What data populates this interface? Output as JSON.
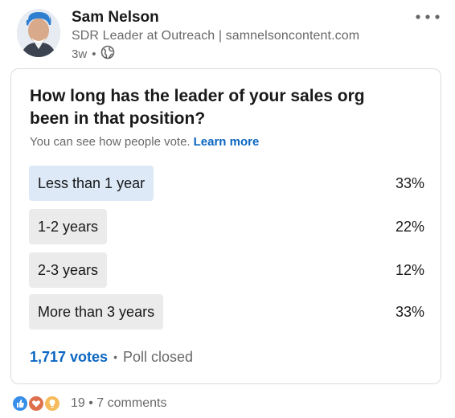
{
  "author": {
    "name": "Sam Nelson",
    "headline": "SDR Leader at Outreach | samnelsoncontent.com",
    "time": "3w",
    "visibility_icon": "globe-icon"
  },
  "poll": {
    "question": "How long has the leader of your sales org been in that position?",
    "note": "You can see how people vote.",
    "learn_more": "Learn more",
    "options": [
      {
        "label": "Less than 1 year",
        "percent_text": "33%",
        "percent": 33,
        "selected": true
      },
      {
        "label": "1-2 years",
        "percent_text": "22%",
        "percent": 22,
        "selected": false
      },
      {
        "label": "2-3 years",
        "percent_text": "12%",
        "percent": 12,
        "selected": false
      },
      {
        "label": "More than 3 years",
        "percent_text": "33%",
        "percent": 33,
        "selected": false
      }
    ],
    "votes": "1,717 votes",
    "status": "Poll closed"
  },
  "social": {
    "reactions": [
      "like-icon",
      "love-icon",
      "insightful-icon"
    ],
    "reaction_count": "19",
    "comments": "7 comments"
  },
  "colors": {
    "selected_fill": "#dde9f7",
    "unselected_fill": "#ebebeb",
    "link": "#0a66c2"
  }
}
